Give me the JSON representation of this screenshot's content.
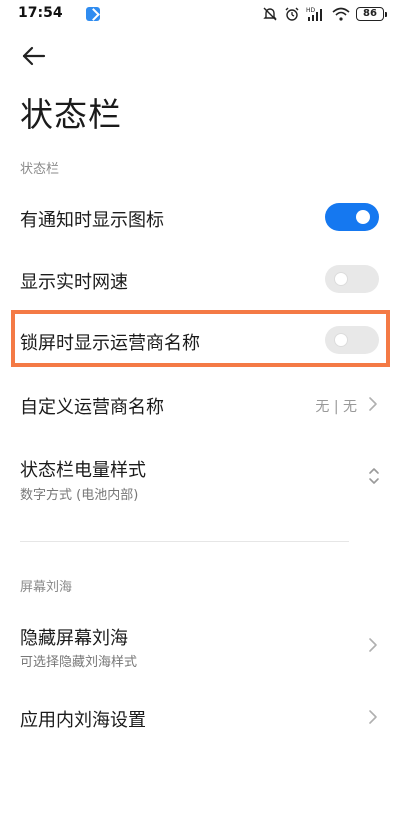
{
  "status_bar": {
    "time": "17:54",
    "battery": "86",
    "icons": [
      "app-notification-icon",
      "mute-icon",
      "alarm-icon",
      "hd-signal-icon",
      "wifi-icon",
      "battery-icon"
    ]
  },
  "header": {
    "back_icon": "back-arrow-icon",
    "title": "状态栏"
  },
  "sections": [
    {
      "title": "状态栏",
      "items": [
        {
          "label": "有通知时显示图标",
          "control": "toggle",
          "on": true
        },
        {
          "label": "显示实时网速",
          "control": "toggle",
          "on": false
        },
        {
          "label": "锁屏时显示运营商名称",
          "control": "toggle",
          "on": false,
          "highlighted": true
        },
        {
          "label": "自定义运营商名称",
          "value": "无 | 无",
          "control": "chevron-right-icon"
        },
        {
          "label": "状态栏电量样式",
          "subtitle": "数字方式 (电池内部)",
          "control": "up-down-icon"
        }
      ]
    },
    {
      "title": "屏幕刘海",
      "items": [
        {
          "label": "隐藏屏幕刘海",
          "subtitle": "可选择隐藏刘海样式",
          "control": "chevron-right-icon"
        },
        {
          "label": "应用内刘海设置",
          "control": "chevron-right-icon"
        }
      ]
    }
  ],
  "colors": {
    "toggle_on": "#1578f0",
    "toggle_off": "#e8e8e8",
    "highlight_border": "#f47a45"
  }
}
